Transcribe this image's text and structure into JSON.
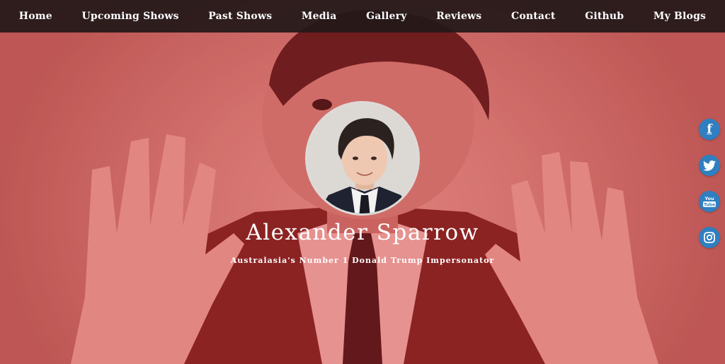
{
  "nav": {
    "items": [
      {
        "label": "Home"
      },
      {
        "label": "Upcoming Shows"
      },
      {
        "label": "Past Shows"
      },
      {
        "label": "Media"
      },
      {
        "label": "Gallery"
      },
      {
        "label": "Reviews"
      },
      {
        "label": "Contact"
      },
      {
        "label": "Github"
      },
      {
        "label": "My Blogs"
      }
    ]
  },
  "hero": {
    "name": "Alexander Sparrow",
    "tagline": "Australasia's Number 1 Donald Trump Impersonator",
    "overlay_color": "#d74646"
  },
  "social": {
    "items": [
      {
        "icon": "facebook-icon",
        "glyph": "f"
      },
      {
        "icon": "twitter-icon",
        "glyph": "🐦"
      },
      {
        "icon": "youtube-icon",
        "glyph": "You\nTube"
      },
      {
        "icon": "instagram-icon",
        "glyph": "◎"
      }
    ],
    "color": "#2f7fc1"
  }
}
